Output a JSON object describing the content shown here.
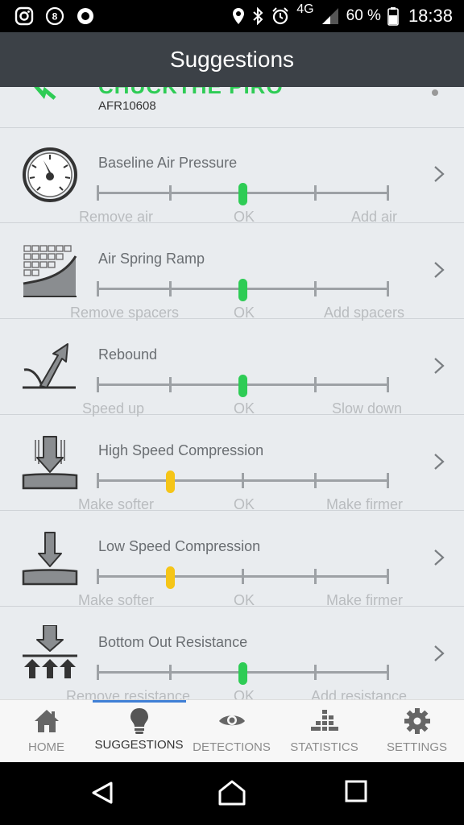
{
  "status_bar": {
    "network": "4G",
    "battery": "60 %",
    "time": "18:38"
  },
  "header": {
    "title": "Suggestions"
  },
  "device": {
    "name": "CHUCKTHE PIRO",
    "id": "AFR10608"
  },
  "suggestions": [
    {
      "label": "Baseline Air Pressure",
      "icon": "pressure-gauge-icon",
      "left": "Remove air",
      "mid": "OK",
      "right": "Add air",
      "level": "OK",
      "color": "#2ecc55"
    },
    {
      "label": "Air Spring Ramp",
      "icon": "spring-ramp-icon",
      "left": "Remove spacers",
      "mid": "OK",
      "right": "Add spacers",
      "level": "OK",
      "color": "#2ecc55"
    },
    {
      "label": "Rebound",
      "icon": "rebound-icon",
      "left": "Speed up",
      "mid": "OK",
      "right": "Slow down",
      "level": "OK",
      "color": "#2ecc55"
    },
    {
      "label": "High Speed Compression",
      "icon": "high-speed-compression-icon",
      "left": "Make softer",
      "mid": "OK",
      "right": "Make firmer",
      "level": "slightly softer",
      "color": "#f5c518"
    },
    {
      "label": "Low Speed Compression",
      "icon": "low-speed-compression-icon",
      "left": "Make softer",
      "mid": "OK",
      "right": "Make firmer",
      "level": "slightly softer",
      "color": "#f5c518"
    },
    {
      "label": "Bottom Out Resistance",
      "icon": "bottom-out-resistance-icon",
      "left": "Remove resistance",
      "mid": "OK",
      "right": "Add resistance",
      "level": "OK",
      "color": "#2ecc55"
    }
  ],
  "tabs": [
    {
      "label": "HOME",
      "icon": "home-icon",
      "active": false
    },
    {
      "label": "SUGGESTIONS",
      "icon": "lightbulb-icon",
      "active": true
    },
    {
      "label": "DETECTIONS",
      "icon": "eye-icon",
      "active": false
    },
    {
      "label": "STATISTICS",
      "icon": "bar-stack-icon",
      "active": false
    },
    {
      "label": "SETTINGS",
      "icon": "gear-icon",
      "active": false
    }
  ],
  "colors": {
    "ok": "#2ecc55",
    "warn": "#f5c518",
    "header": "#3c4147",
    "tab_indicator": "#3f7fd6"
  }
}
